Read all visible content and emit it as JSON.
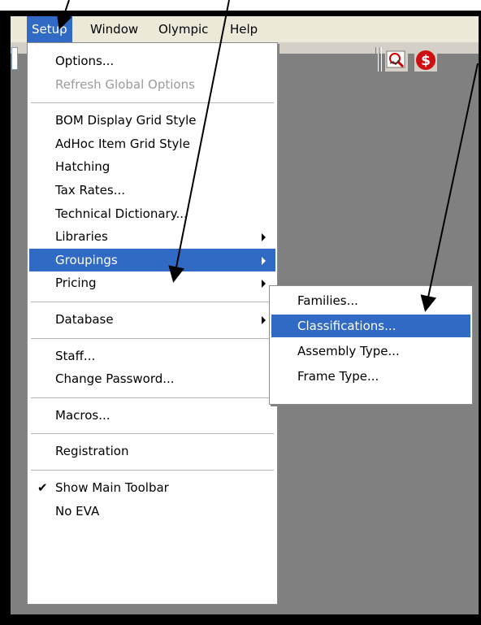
{
  "menubar": {
    "items": [
      "Setup",
      "Window",
      "Olympic",
      "Help"
    ],
    "active": "Setup"
  },
  "setup_menu": {
    "items": [
      {
        "label": "Options..."
      },
      {
        "label": "Refresh Global Options",
        "disabled": true
      },
      {
        "separator": true
      },
      {
        "label": "BOM Display Grid Style"
      },
      {
        "label": "AdHoc Item Grid Style"
      },
      {
        "label": "Hatching"
      },
      {
        "label": "Tax Rates..."
      },
      {
        "label": "Technical Dictionary..."
      },
      {
        "label": "Libraries",
        "submenu": true
      },
      {
        "label": "Groupings",
        "submenu": true,
        "highlight": true
      },
      {
        "label": "Pricing",
        "submenu": true
      },
      {
        "separator": true
      },
      {
        "label": "Database",
        "submenu": true
      },
      {
        "separator": true
      },
      {
        "label": "Staff..."
      },
      {
        "label": "Change Password..."
      },
      {
        "separator": true
      },
      {
        "label": "Macros..."
      },
      {
        "separator": true
      },
      {
        "label": "Registration"
      },
      {
        "separator": true
      },
      {
        "label": "Show Main Toolbar",
        "checked": true
      },
      {
        "label": "No EVA"
      }
    ]
  },
  "groupings_submenu": {
    "items": [
      {
        "label": "Families..."
      },
      {
        "label": "Classifications...",
        "highlight": true
      },
      {
        "label": "Assembly Type..."
      },
      {
        "label": "Frame Type..."
      }
    ]
  },
  "colors": {
    "highlight": "#316ac5",
    "workspace": "#808080",
    "menubar": "#ece9d8",
    "toolbar": "#d4d0c8",
    "arrow": "#000000"
  },
  "icons": [
    "search-settings-icon",
    "pricing-icon"
  ]
}
